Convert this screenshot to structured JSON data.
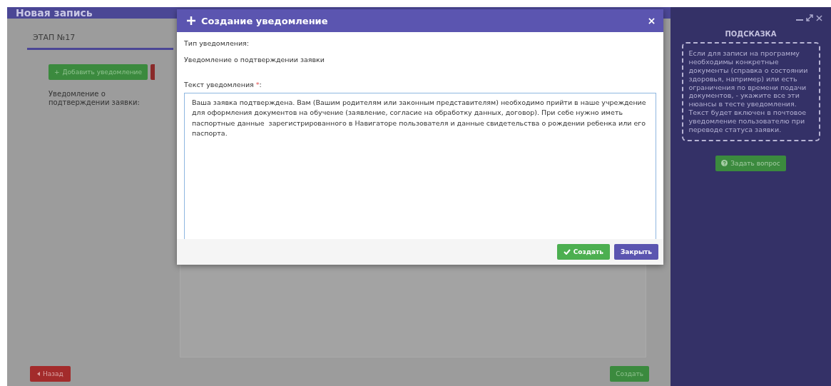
{
  "window": {
    "title": "Новая запись"
  },
  "stage_tab": {
    "label": "ЭТАП №17",
    "selected": true
  },
  "toolbar": {
    "add_button": {
      "icon": "+",
      "label": "Добавить уведомление"
    }
  },
  "notification_label": "Уведомление о подтверждении заявки:",
  "footer": {
    "back_button": {
      "label": "Назад"
    },
    "create_button": {
      "label": "Создать"
    }
  },
  "hint_panel": {
    "title": "ПОДСКАЗКА",
    "text": "Если для записи на программу необходимы конкретные документы (справка о состоянии здоровья, например) или есть ограничения по времени подачи документов, - укажите все эти нюансы в тесте уведомления. Текст будет включен в почтовое уведомление пользователю при переводе статуса заявки.",
    "ask_button": {
      "label": "Задать вопрос"
    }
  },
  "dialog": {
    "title": "Создание уведомление",
    "type_label": "Тип уведомления:",
    "type_value": "Уведомление о подтверждении заявки",
    "text_label": "Текст уведомления",
    "required_mark": "*",
    "label_suffix": ":",
    "text_value": "Ваша заявка подтверждена. Вам (Вашим родителям или законным представителям) необходимо прийти в наше учреждение для оформления документов на обучение (заявление, согласие на обработку данных, договор). При себе нужно иметь паспортные данные  зарегистрированного в Навигаторе пользователя и данные свидетельства о рождении ребенка или его паспорта.",
    "buttons": [
      {
        "kind": "confirm",
        "label": "Создать"
      },
      {
        "kind": "close",
        "label": "Закрыть"
      }
    ]
  }
}
